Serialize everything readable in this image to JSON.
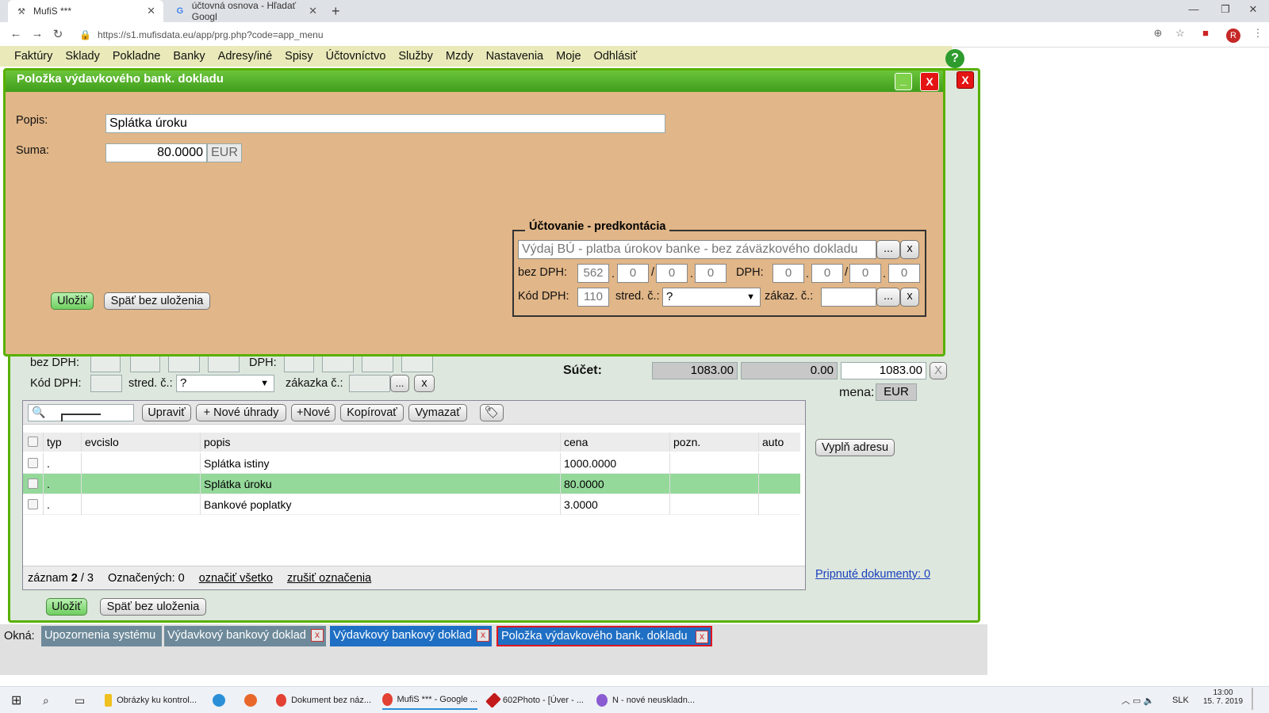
{
  "browser": {
    "tabs": [
      {
        "title": "MufiS ***",
        "favicon": "mufis-icon"
      },
      {
        "title": "účtovná osnova - Hľadať Googl",
        "favicon": "google-icon"
      }
    ],
    "new_tab": "+",
    "url": "https://s1.mufisdata.eu/app/prg.php?code=app_menu",
    "avatar": "R"
  },
  "menu": {
    "items": [
      "Faktúry",
      "Sklady",
      "Pokladne",
      "Banky",
      "Adresy/iné",
      "Spisy",
      "Účtovníctvo",
      "Služby",
      "Mzdy",
      "Nastavenia",
      "Moje",
      "Odhlásiť"
    ],
    "help": "?"
  },
  "modal": {
    "title": "Položka výdavkového bank. dokladu",
    "minimize": "_",
    "close": "X",
    "popis_label": "Popis:",
    "popis_value": "Splátka úroku",
    "suma_label": "Suma:",
    "suma_value": "80.0000",
    "suma_currency": "EUR",
    "save": "Uložiť",
    "back": "Späť bez uloženia",
    "fieldset": {
      "legend": "Účtovanie - predkontácia",
      "predkontacia": "Výdaj BÚ - platba úrokov banke - bez záväzkového dokladu",
      "dots": "...",
      "x": "x",
      "bez_dph_label": "bez DPH:",
      "bez_dph": [
        "562",
        "0",
        "0",
        "0"
      ],
      "dph_label": "DPH:",
      "dph": [
        "0",
        "0",
        "0",
        "0"
      ],
      "dot_sep": ".",
      "slash_sep": "/",
      "kod_dph_label": "Kód DPH:",
      "kod_dph": "110",
      "stred_label": "stred. č.:",
      "stred_value": "?",
      "zakaz_label": "zákaz. č.:"
    }
  },
  "background": {
    "close": "X",
    "bez_dph_label": "bez DPH:",
    "dph_label": "DPH:",
    "kod_dph_label": "Kód DPH:",
    "stred_label": "stred. č.:",
    "stred_value": "?",
    "zakazka_label": "zákazka č.:",
    "dots": "...",
    "x": "x",
    "sucet_label": "Súčet:",
    "sucet_values": [
      "1083.00",
      "0.00",
      "1083.00"
    ],
    "sucet_x": "X",
    "mena_label": "mena:",
    "mena_value": "EUR",
    "vypln_adresu": "Vyplň adresu",
    "pripnute": "Pripnuté dokumenty: 0",
    "save": "Uložiť",
    "back": "Späť bez uloženia",
    "grid": {
      "buttons": [
        "Upraviť",
        "+ Nové úhrady",
        "+Nové",
        "Kopírovať",
        "Vymazať"
      ],
      "columns": [
        "typ",
        "evcislo",
        "popis",
        "cena",
        "pozn.",
        "auto"
      ],
      "rows": [
        {
          "typ": ".",
          "evcislo": "",
          "popis": "Splátka istiny",
          "cena": "1000.0000",
          "pozn": "",
          "auto": "",
          "selected": false
        },
        {
          "typ": ".",
          "evcislo": "",
          "popis": "Splátka úroku",
          "cena": "80.0000",
          "pozn": "",
          "auto": "",
          "selected": true
        },
        {
          "typ": ".",
          "evcislo": "",
          "popis": "Bankové poplatky",
          "cena": "3.0000",
          "pozn": "",
          "auto": "",
          "selected": false
        }
      ],
      "footer": {
        "zaznam_label": "záznam",
        "zaznam_current": "2",
        "zaznam_sep": "/",
        "zaznam_total": "3",
        "oznacenych": "Označených: 0",
        "oznacit_vsetko": "označiť všetko",
        "zrusit": "zrušiť označenia"
      }
    }
  },
  "okna": {
    "label": "Okná:",
    "tabs": [
      {
        "title": "Upozornenia systému",
        "color": "#6e8a9a",
        "closable": false
      },
      {
        "title": "Výdavkový bankový doklad",
        "color": "#6e8a9a",
        "closable": true
      },
      {
        "title": "Výdavkový bankový doklad",
        "color": "#1f6fc4",
        "closable": true
      },
      {
        "title": "Položka výdavkového bank. dokladu",
        "color": "#1f6fc4",
        "closable": true,
        "active": true
      }
    ],
    "close": "x"
  },
  "taskbar": {
    "items": [
      "Obrázky ku kontrol...",
      "Dokument bez náz...",
      "MufiS *** - Google ...",
      "602Photo - [Úver - ...",
      "N - nové neuskladn..."
    ],
    "lang": "SLK",
    "time": "13:00",
    "date": "15. 7. 2019"
  },
  "colors": {
    "accent_green": "#58b000",
    "modal_bg": "#e1b688",
    "menubar": "#e9e9b9",
    "selected_row": "#94d89a"
  }
}
